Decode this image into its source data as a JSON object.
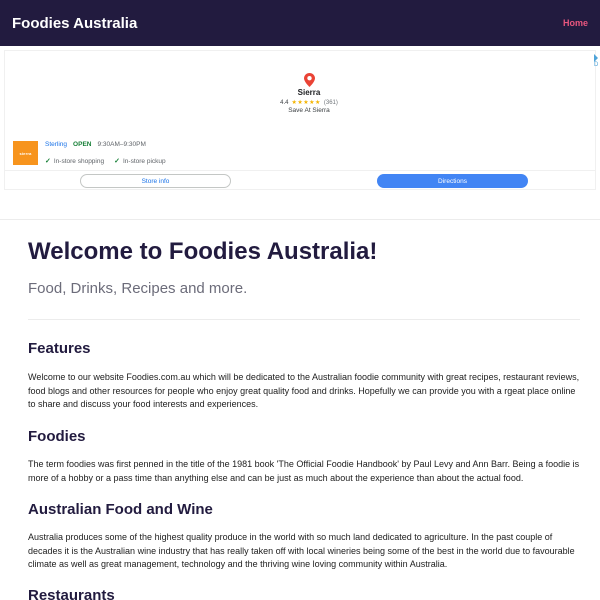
{
  "nav": {
    "brand": "Foodies Australia",
    "home_label": "Home"
  },
  "ad": {
    "store_name": "Sierra",
    "rating": "4.4",
    "stars": "★★★★★",
    "rating_count": "(361)",
    "save_text": "Save At Sierra",
    "logo_text": "sierra",
    "location_city": "Sterling",
    "status": "OPEN",
    "hours": "9:30AM–9:30PM",
    "services": [
      "In-store shopping",
      "In-store pickup"
    ],
    "store_info_label": "Store info",
    "directions_label": "Directions",
    "adchoice_label": "D"
  },
  "main": {
    "title": "Welcome to Foodies Australia!",
    "lead": "Food, Drinks, Recipes and more.",
    "sections": [
      {
        "heading": "Features",
        "body": "Welcome to our website Foodies.com.au which will be dedicated to the Australian foodie community with great recipes, restaurant reviews, food blogs and other resources for people who enjoy great quality food and drinks. Hopefully we can provide you with a rgeat place online to share and discuss your food interests and experiences."
      },
      {
        "heading": "Foodies",
        "body": "The term foodies was first penned in the title of the 1981 book 'The Official Foodie Handbook' by Paul Levy and Ann Barr. Being a foodie is more of a hobby or a pass time than anything else and can be just as much about the experience than about the actual food."
      },
      {
        "heading": "Australian Food and Wine",
        "body": "Australia produces some of the highest quality produce in the world with so much land dedicated to agriculture. In the past couple of decades it is the Australian wine industry that has really taken off with local wineries being some of the best in the world due to favourable climate as well as great management, technology and the thriving wine loving community within Australia."
      },
      {
        "heading": "Restaurants"
      }
    ]
  },
  "colors": {
    "navbar_bg": "#221b3f",
    "nav_link": "#e8567e",
    "heading": "#221b3f",
    "lead": "#6c6c7a",
    "ad_blue": "#4285f4",
    "ad_green": "#188038",
    "logo_orange": "#f7941d"
  }
}
